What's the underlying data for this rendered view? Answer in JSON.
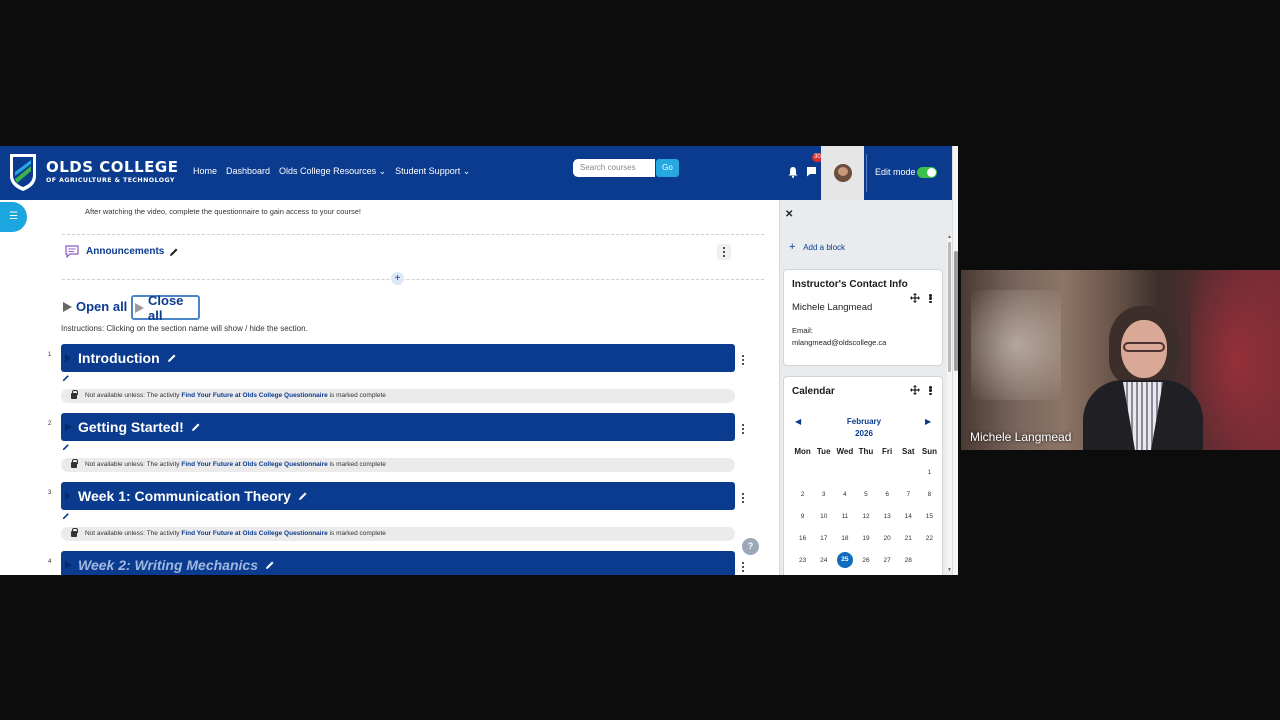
{
  "navbar": {
    "logo_main": "OLDS COLLEGE",
    "logo_sub": "OF AGRICULTURE & TECHNOLOGY",
    "links": {
      "home": "Home",
      "dashboard": "Dashboard",
      "resources": "Olds College Resources",
      "support": "Student Support"
    },
    "search_placeholder": "Search courses",
    "go_label": "Go",
    "message_count": "30",
    "edit_mode_label": "Edit mode",
    "edit_mode_on": true
  },
  "course": {
    "intro_text": "After watching the video, complete the questionnaire to gain access to your course!",
    "announcements_label": "Announcements",
    "open_all": "Open all",
    "close_all": "Close all",
    "instructions": "Instructions: Clicking on the section name will show / hide the section.",
    "restriction": {
      "prefix": "Not available unless: The activity",
      "activity": "Find Your Future at Olds College Questionnaire",
      "suffix": "is marked complete"
    },
    "sections": [
      {
        "num": "1",
        "title": "Introduction"
      },
      {
        "num": "2",
        "title": "Getting Started!"
      },
      {
        "num": "3",
        "title": "Week 1: Communication Theory"
      },
      {
        "num": "4",
        "title": "Week 2: Writing Mechanics"
      }
    ]
  },
  "drawer": {
    "add_block": "Add a block",
    "contact": {
      "title": "Instructor's Contact Info",
      "name": "Michele Langmead",
      "email_label": "Email:",
      "email": "mlangmead@oldscollege.ca"
    },
    "calendar": {
      "title": "Calendar",
      "month": "February",
      "year": "2026",
      "weekdays": [
        "Mon",
        "Tue",
        "Wed",
        "Thu",
        "Fri",
        "Sat",
        "Sun"
      ],
      "today": "25",
      "days": [
        "",
        "",
        "",
        "",
        "",
        "",
        "1",
        "2",
        "3",
        "4",
        "5",
        "6",
        "7",
        "8",
        "9",
        "10",
        "11",
        "12",
        "13",
        "14",
        "15",
        "16",
        "17",
        "18",
        "19",
        "20",
        "21",
        "22",
        "23",
        "24",
        "25",
        "26",
        "27",
        "28",
        ""
      ]
    }
  },
  "webcam": {
    "participant_name": "Michele Langmead"
  },
  "help_label": "?"
}
